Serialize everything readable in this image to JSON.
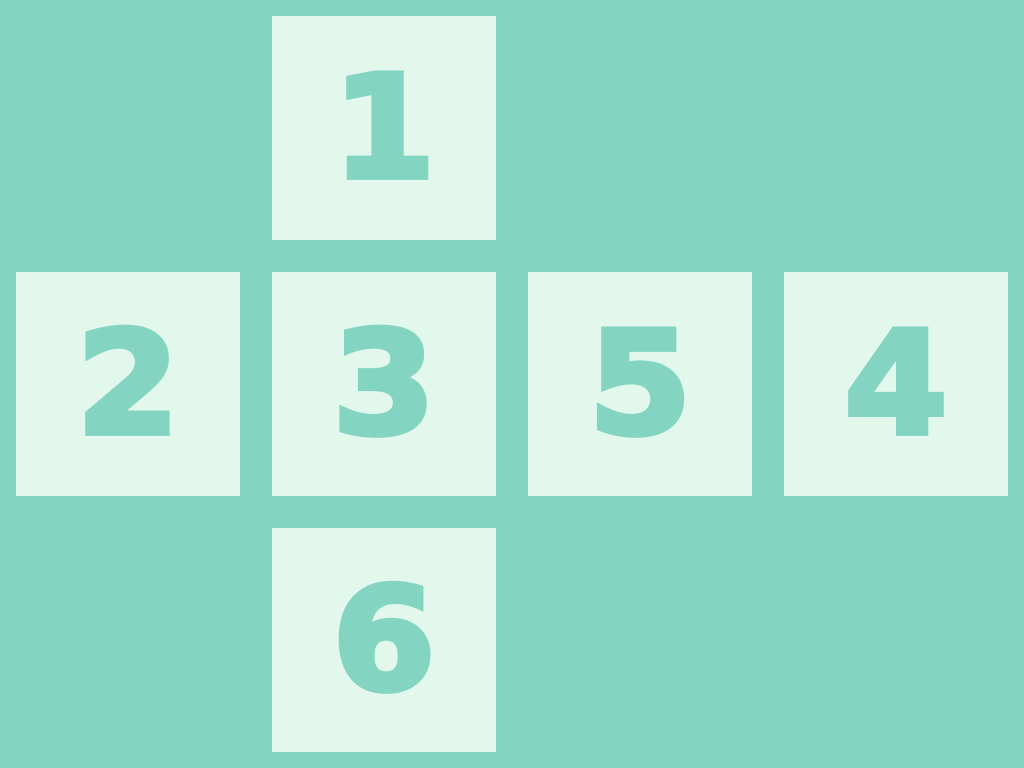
{
  "colors": {
    "background": "#84d4c2",
    "face_fill": "#e2f8ec",
    "digit_color": "#84d4c2"
  },
  "net": {
    "top": {
      "label": "1"
    },
    "left": {
      "label": "2"
    },
    "center": {
      "label": "3"
    },
    "right1": {
      "label": "5"
    },
    "right2": {
      "label": "4"
    },
    "bottom": {
      "label": "6"
    }
  }
}
